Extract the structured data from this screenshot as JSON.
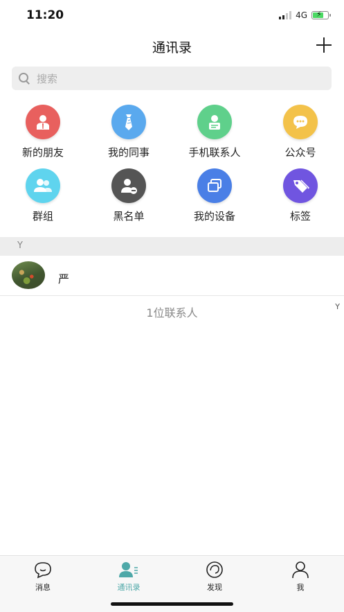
{
  "status_bar": {
    "time": "11:20",
    "network": "4G"
  },
  "header": {
    "title": "通讯录"
  },
  "search": {
    "placeholder": "搜索"
  },
  "features": [
    {
      "label": "新的朋友",
      "icon": "new-friend-icon",
      "color": "#e8605e"
    },
    {
      "label": "我的同事",
      "icon": "tie-icon",
      "color": "#5aa9ee"
    },
    {
      "label": "手机联系人",
      "icon": "phone-contact-icon",
      "color": "#5fd08b"
    },
    {
      "label": "公众号",
      "icon": "chat-bubble-icon",
      "color": "#f3c24a"
    },
    {
      "label": "群组",
      "icon": "group-icon",
      "color": "#5fd4ee"
    },
    {
      "label": "黑名单",
      "icon": "blocked-user-icon",
      "color": "#555555"
    },
    {
      "label": "我的设备",
      "icon": "devices-icon",
      "color": "#4a7fe6"
    },
    {
      "label": "标签",
      "icon": "tag-icon",
      "color": "#7055e0"
    }
  ],
  "contacts": {
    "section_letter": "Y",
    "items": [
      {
        "name": "严"
      }
    ],
    "index_letter": "Y",
    "count_text": "1位联系人"
  },
  "tabs": [
    {
      "label": "消息",
      "icon": "message-icon",
      "active": false
    },
    {
      "label": "通讯录",
      "icon": "contacts-icon",
      "active": true
    },
    {
      "label": "发现",
      "icon": "discover-icon",
      "active": false
    },
    {
      "label": "我",
      "icon": "profile-icon",
      "active": false
    }
  ],
  "colors": {
    "active_tab": "#4ea8a8",
    "section_bg": "#ededed"
  }
}
